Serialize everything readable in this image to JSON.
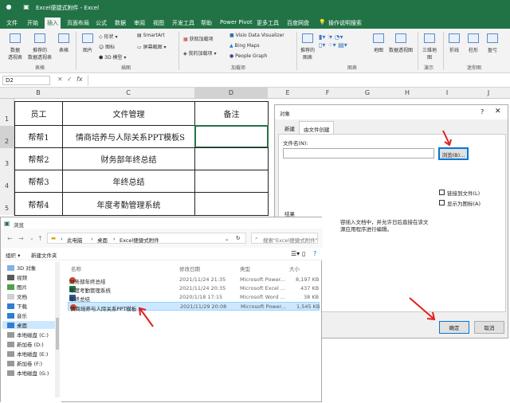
{
  "window": {
    "title": "Excel便捷式附件 - Excel",
    "save_icon": "save-icon"
  },
  "menu": [
    "文件",
    "开始",
    "插入",
    "页面布局",
    "公式",
    "数据",
    "审阅",
    "视图",
    "开发工具",
    "帮助",
    "Power Pivot",
    "更多工具",
    "百度网盘",
    "操作说明搜索"
  ],
  "ribbon": {
    "tables": [
      "数据\n透视表",
      "推荐的\n数据透视表",
      "表格"
    ],
    "illus": [
      "图片",
      "形状 ▾",
      "图标",
      "3D 模型 ▾",
      "SmartArt",
      "屏幕截图 ▾"
    ],
    "addins": [
      "获取加载项",
      "我的加载项 ▾",
      "Visio Data Visualizer",
      "Bing Maps",
      "People Graph"
    ],
    "charts": [
      "推荐的\n图表",
      "地图",
      "数据透视图",
      "三维地\n图",
      "折线",
      "柱形",
      "盈亏"
    ],
    "groups": [
      "表格",
      "插图",
      "加载项",
      "图表",
      "演示",
      "迷你图"
    ]
  },
  "formula": {
    "namebox": "D2",
    "fx": "fx"
  },
  "grid": {
    "cols": [
      "B",
      "C",
      "D",
      "E",
      "F",
      "G",
      "H",
      "I",
      "J"
    ],
    "rows": [
      "1",
      "2",
      "3",
      "4",
      "5"
    ],
    "header": [
      "员工",
      "文件管理",
      "备注"
    ],
    "data": [
      [
        "帮帮1",
        "情商培养与人际关系PPT模板S"
      ],
      [
        "帮帮2",
        "财务部年终总结"
      ],
      [
        "帮帮3",
        "年终总结"
      ],
      [
        "帮帮4",
        "年度考勤管理系统"
      ]
    ]
  },
  "obj_dialog": {
    "title": "对象",
    "help": "?",
    "tab_new": "新建",
    "tab_file": "由文件创建",
    "filename_label": "文件名(N):",
    "browse": "浏览(B)...",
    "link": "链接到文件(L)",
    "icon": "显示为图标(A)",
    "result_label": "结果",
    "result_text": "容插入文档中，并允许日后直接在该文\n源应用程序进行编辑。",
    "ok": "确定",
    "cancel": "取消"
  },
  "browse_dialog": {
    "title": "浏览",
    "path": [
      "此电脑",
      "桌面",
      "Excel便捷式附件"
    ],
    "search_placeholder": "搜索\"Excel便捷式附件\"",
    "organize": "组织 ▾",
    "new_folder": "新建文件夹",
    "cols": [
      "名称",
      "修改日期",
      "类型",
      "大小"
    ],
    "files": [
      {
        "name": "财务部年终总结",
        "date": "2021/11/24 21:35",
        "type": "Microsoft Power...",
        "size": "8,197 KB",
        "icon": "ppt"
      },
      {
        "name": "年度考勤管理系统",
        "date": "2021/11/24 20:35",
        "type": "Microsoft Excel ...",
        "size": "437 KB",
        "icon": "excel"
      },
      {
        "name": "年终总结",
        "date": "2020/1/18 17:15",
        "type": "Microsoft Word ...",
        "size": "38 KB",
        "icon": "word"
      },
      {
        "name": "情商培养与人际关系PPT模板",
        "date": "2021/11/29 20:08",
        "type": "Microsoft Power...",
        "size": "1,545 KB",
        "icon": "ppt",
        "selected": true
      }
    ],
    "tree": [
      "3D 对象",
      "视频",
      "图片",
      "文档",
      "下载",
      "音乐",
      "桌面",
      "本地磁盘 (C:)",
      "新加卷 (D:)",
      "本地磁盘 (E:)",
      "新加卷 (F:)",
      "本地磁盘 (G:)"
    ]
  },
  "colors": {
    "excel_green": "#217346",
    "arrow_red": "#e02020",
    "selection": "#cce8ff"
  }
}
